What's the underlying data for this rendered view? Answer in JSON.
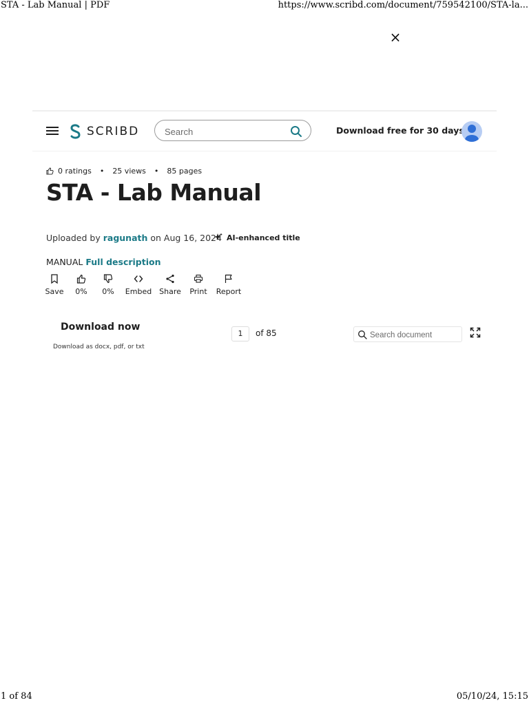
{
  "print_header": {
    "page_title": "STA - Lab Manual | PDF",
    "url": "https://www.scribd.com/document/759542100/STA-la..."
  },
  "print_footer": {
    "page_count": "1 of 84",
    "timestamp": "05/10/24, 15:15"
  },
  "overlay": {
    "close_glyph": "×"
  },
  "topbar": {
    "logo_text": "SCRIBD",
    "search_placeholder": "Search",
    "download_free_label": "Download free for 30 days",
    "brand_color": "#1b7a87"
  },
  "document": {
    "ratings": "0 ratings",
    "views": "25 views",
    "pages": "85 pages",
    "separator": "•",
    "title": "STA - Lab Manual",
    "uploaded_prefix": "Uploaded by",
    "uploader": "ragunath",
    "uploaded_date": "on Aug 16, 2024",
    "ai_enhanced_label": "AI-enhanced title",
    "category": "MANUAL",
    "full_description_link": "Full description"
  },
  "actions": [
    {
      "label": "Save",
      "icon": "bookmark-icon"
    },
    {
      "label": "0%",
      "icon": "thumbs-up-icon"
    },
    {
      "label": "0%",
      "icon": "thumbs-down-icon"
    },
    {
      "label": "Embed",
      "icon": "code-icon"
    },
    {
      "label": "Share",
      "icon": "share-icon"
    },
    {
      "label": "Print",
      "icon": "printer-icon"
    },
    {
      "label": "Report",
      "icon": "flag-icon"
    }
  ],
  "viewer": {
    "download_now_label": "Download now",
    "download_formats": "Download as docx, pdf, or txt",
    "current_page": "1",
    "of_pages": "of 85",
    "search_document_placeholder": "Search document"
  }
}
